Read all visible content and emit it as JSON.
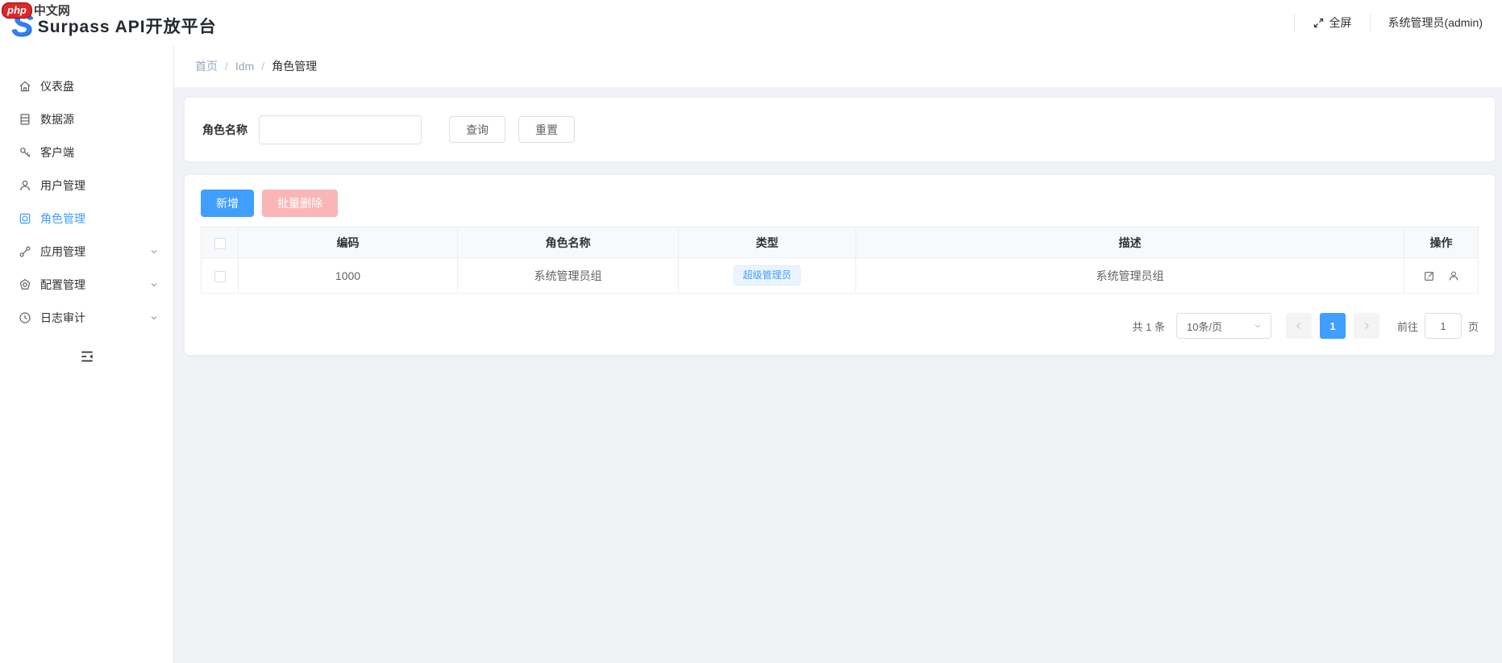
{
  "header": {
    "logo_letter": "S",
    "title": "Surpass API开放平台",
    "fullscreen_label": "全屏",
    "user_label": "系统管理员(admin)",
    "watermark_php": "php",
    "watermark_cn": "中文网"
  },
  "sidebar": {
    "items": [
      {
        "label": "仪表盘",
        "icon": "dashboard-icon",
        "active": false,
        "expandable": false
      },
      {
        "label": "数据源",
        "icon": "datasource-icon",
        "active": false,
        "expandable": false
      },
      {
        "label": "客户端",
        "icon": "key-icon",
        "active": false,
        "expandable": false
      },
      {
        "label": "用户管理",
        "icon": "user-icon",
        "active": false,
        "expandable": false
      },
      {
        "label": "角色管理",
        "icon": "role-icon",
        "active": true,
        "expandable": false
      },
      {
        "label": "应用管理",
        "icon": "app-link-icon",
        "active": false,
        "expandable": true
      },
      {
        "label": "配置管理",
        "icon": "settings-icon",
        "active": false,
        "expandable": true
      },
      {
        "label": "日志审计",
        "icon": "clock-icon",
        "active": false,
        "expandable": true
      }
    ]
  },
  "breadcrumb": {
    "items": [
      "首页",
      "Idm",
      "角色管理"
    ],
    "separator": "/"
  },
  "search": {
    "label": "角色名称",
    "input_value": "",
    "query_label": "查询",
    "reset_label": "重置"
  },
  "toolbar": {
    "add_label": "新增",
    "batch_delete_label": "批量删除"
  },
  "table": {
    "columns": [
      "编码",
      "角色名称",
      "类型",
      "描述",
      "操作"
    ],
    "rows": [
      {
        "code": "1000",
        "name": "系统管理员组",
        "type_tag": "超级管理员",
        "description": "系统管理员组"
      }
    ]
  },
  "pagination": {
    "total_text": "共 1 条",
    "page_size": "10条/页",
    "current_page": "1",
    "goto_label": "前往",
    "goto_value": "1",
    "page_suffix": "页"
  },
  "colors": {
    "accent": "#409eff",
    "danger_disabled": "#fab6b6",
    "tag_bg": "#ecf5ff",
    "tag_border": "#d9ecff",
    "background": "#f0f2f5"
  }
}
